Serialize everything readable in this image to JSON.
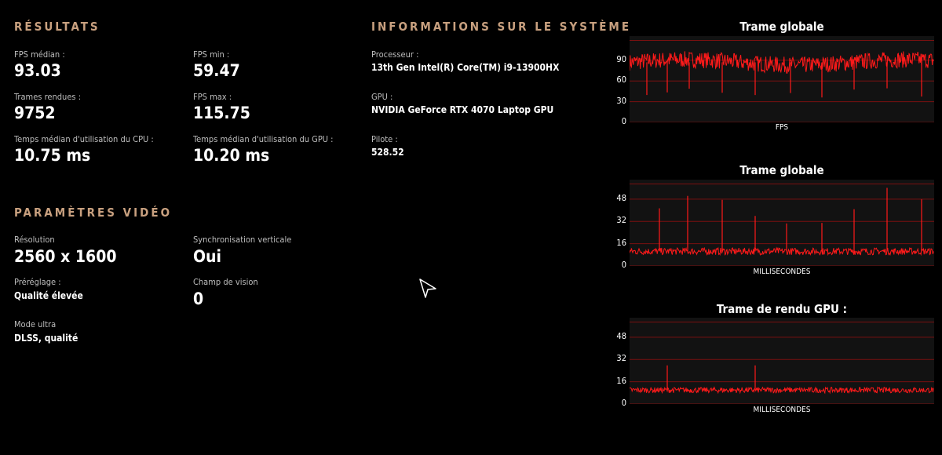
{
  "results": {
    "title": "RÉSULTATS",
    "fps_median_label": "FPS médian :",
    "fps_median_value": "93.03",
    "fps_min_label": "FPS min :",
    "fps_min_value": "59.47",
    "frames_label": "Trames rendues :",
    "frames_value": "9752",
    "fps_max_label": "FPS max :",
    "fps_max_value": "115.75",
    "cpu_label": "Temps médian d'utilisation du CPU :",
    "cpu_value": "10.75 ms",
    "gpu_label": "Temps médian d'utilisation du GPU :",
    "gpu_value": "10.20 ms"
  },
  "video": {
    "title": "PARAMÈTRES VIDÉO",
    "resolution_label": "Résolution",
    "resolution_value": "2560 x 1600",
    "vsync_label": "Synchronisation verticale",
    "vsync_value": "Oui",
    "preset_label": "Préréglage :",
    "preset_value": "Qualité élevée",
    "fov_label": "Champ de vision",
    "fov_value": "0",
    "ultra_label": "Mode ultra",
    "ultra_value": "DLSS, qualité"
  },
  "system": {
    "title": "INFORMATIONS SUR LE SYSTÈME",
    "cpu_label": "Processeur :",
    "cpu_value": "13th Gen Intel(R) Core(TM) i9-13900HX",
    "gpu_label": "GPU :",
    "gpu_value": "NVIDIA GeForce RTX 4070 Laptop GPU",
    "driver_label": "Pilote :",
    "driver_value": "528.52"
  },
  "colors": {
    "accent": "#c8a07f",
    "series": "#ff1a1a",
    "grid": "#7a1010"
  },
  "chart_data": [
    {
      "type": "line",
      "title": "Trame globale",
      "xlabel": "FPS",
      "ylabel": "",
      "yticks": [
        0,
        30,
        60,
        90
      ],
      "ylim": [
        0,
        125
      ],
      "series": [
        {
          "baseline": 87,
          "amplitude": 12
        }
      ],
      "spikes_down": [
        22,
        48,
        76,
        118,
        160,
        205,
        245,
        286,
        328,
        372
      ],
      "grid": true
    },
    {
      "type": "line",
      "title": "Trame globale",
      "xlabel": "MILLISECONDES",
      "ylabel": "",
      "yticks": [
        0,
        16,
        32,
        48
      ],
      "ylim": [
        0,
        62
      ],
      "series": [
        {
          "baseline": 10.5,
          "amplitude": 2.5
        }
      ],
      "spikes_up": [
        38,
        74,
        118,
        160,
        200,
        245,
        286,
        328,
        372
      ],
      "grid": true
    },
    {
      "type": "line",
      "title": "Trame de rendu GPU :",
      "xlabel": "MILLISECONDES",
      "ylabel": "",
      "yticks": [
        0,
        16,
        32,
        48
      ],
      "ylim": [
        0,
        62
      ],
      "series": [
        {
          "baseline": 10,
          "amplitude": 2
        }
      ],
      "spikes_up": [
        48,
        160
      ],
      "grid": true
    }
  ]
}
